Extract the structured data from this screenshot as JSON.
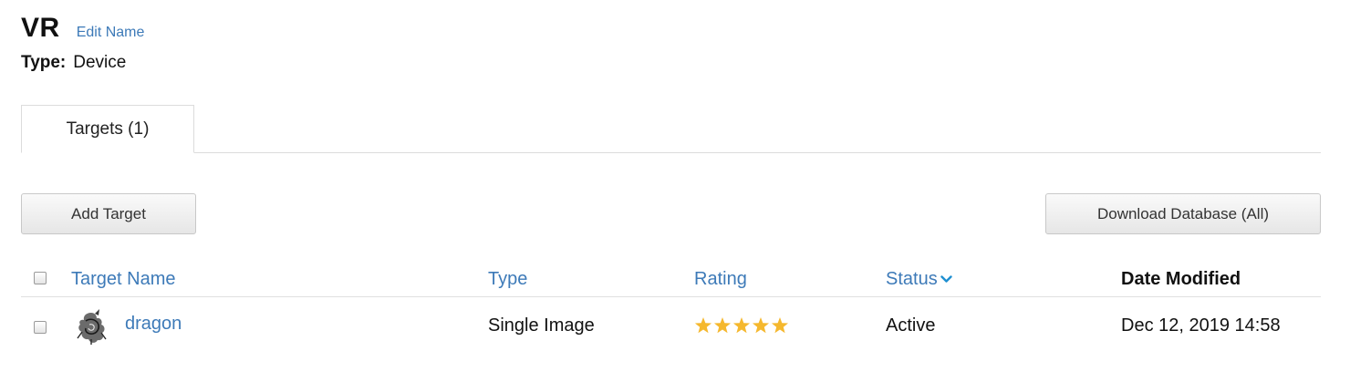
{
  "header": {
    "title": "VR",
    "edit_label": "Edit Name",
    "type_label": "Type:",
    "type_value": "Device"
  },
  "tabs": [
    {
      "label": "Targets (1)",
      "active": true
    }
  ],
  "toolbar": {
    "add_label": "Add Target",
    "download_label": "Download Database (All)"
  },
  "table": {
    "columns": {
      "name": "Target Name",
      "type": "Type",
      "rating": "Rating",
      "status": "Status",
      "date": "Date Modified"
    },
    "sort_column": "status",
    "rows": [
      {
        "name": "dragon",
        "type": "Single Image",
        "rating": 5,
        "rating_max": 5,
        "status": "Active",
        "date": "Dec 12, 2019 14:58"
      }
    ]
  },
  "colors": {
    "link": "#3d7ab8",
    "star": "#f5b82e",
    "chevron": "#1f8fd1"
  },
  "icons": {
    "sort": "chevron-down-icon",
    "thumbnail": "dragon-thumbnail",
    "rating": "star-icon"
  }
}
